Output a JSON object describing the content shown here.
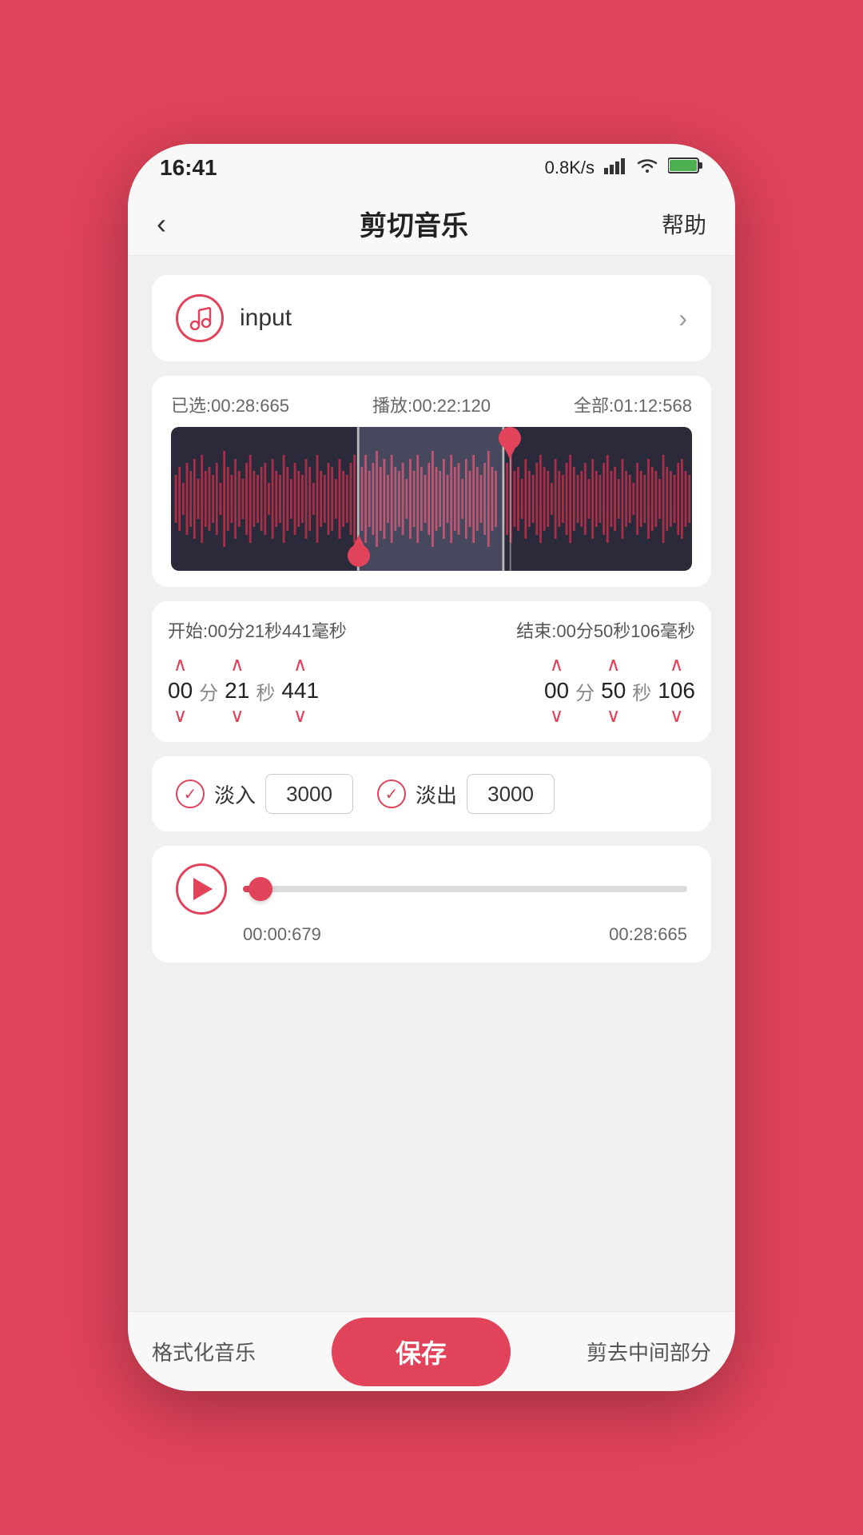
{
  "statusBar": {
    "time": "16:41",
    "network": "0.8K/s",
    "wifi": "wifi",
    "battery": "100"
  },
  "nav": {
    "back": "‹",
    "title": "剪切音乐",
    "help": "帮助"
  },
  "fileCard": {
    "filename": "input",
    "chevron": "›"
  },
  "waveform": {
    "selected": "已选:00:28:665",
    "playback": "播放:00:22:120",
    "total": "全部:01:12:568"
  },
  "startTime": {
    "label": "开始:00分21秒441毫秒",
    "min": "00",
    "minUnit": "分",
    "sec": "21",
    "secUnit": "秒",
    "ms": "441"
  },
  "endTime": {
    "label": "结束:00分50秒106毫秒",
    "min": "00",
    "minUnit": "分",
    "sec": "50",
    "secUnit": "秒",
    "ms": "106"
  },
  "fade": {
    "inLabel": "淡入",
    "inValue": "3000",
    "outLabel": "淡出",
    "outValue": "3000"
  },
  "playback": {
    "currentTime": "00:00:679",
    "totalTime": "00:28:665"
  },
  "bottomBar": {
    "formatMusic": "格式化音乐",
    "save": "保存",
    "cutMiddle": "剪去中间部分"
  }
}
